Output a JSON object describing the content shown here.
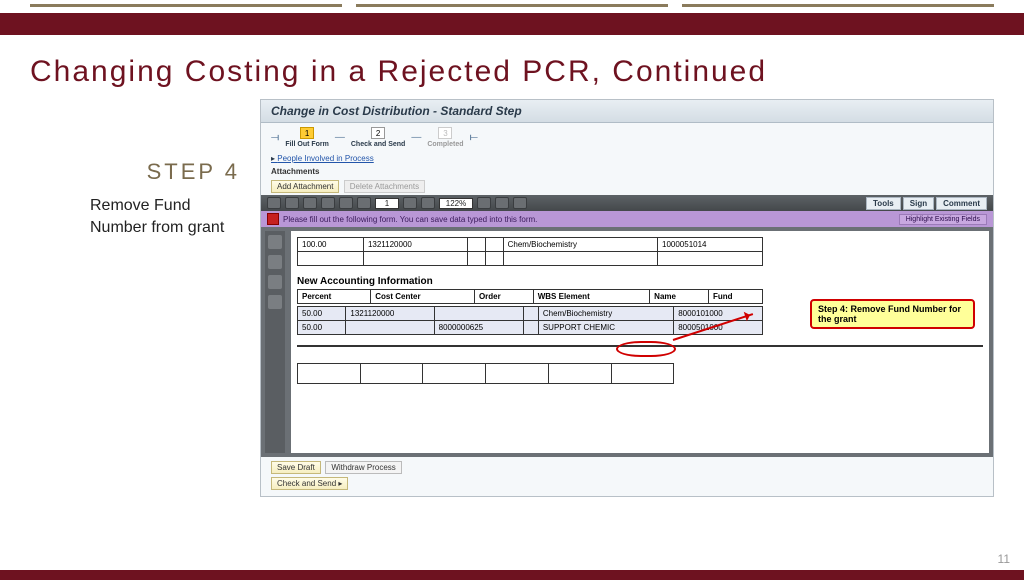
{
  "slide": {
    "title": "Changing Costing in a Rejected PCR, Continued",
    "step_label": "STEP 4",
    "step_text": "Remove Fund Number from grant",
    "page_number": "11"
  },
  "screenshot": {
    "window_title": "Change in Cost Distribution - Standard Step",
    "wizard": {
      "step1": {
        "num": "1",
        "label": "Fill Out Form"
      },
      "step2": {
        "num": "2",
        "label": "Check and Send"
      },
      "step3": {
        "num": "3",
        "label": "Completed"
      }
    },
    "people_link": "People Involved in Process",
    "attachments_label": "Attachments",
    "buttons": {
      "add_attachment": "Add Attachment",
      "delete_attachments": "Delete Attachments",
      "save_draft": "Save Draft",
      "withdraw": "Withdraw Process",
      "check_send": "Check and Send ▸"
    },
    "pdf_toolbar": {
      "page": "1",
      "zoom": "122%",
      "tools": "Tools",
      "sign": "Sign",
      "comment": "Comment"
    },
    "purple_bar": {
      "msg": "Please fill out the following form. You can save data typed into this form.",
      "highlight": "Highlight Existing Fields"
    },
    "top_row": {
      "c1": "100.00",
      "c2": "1321120000",
      "c5": "Chem/Biochemistry",
      "c6": "1000051014"
    },
    "section_title": "New Accounting Information",
    "headers": {
      "h1": "Percent",
      "h2": "Cost Center",
      "h3": "Order",
      "h4": "WBS Element",
      "h5": "Name",
      "h6": "Fund"
    },
    "rows": [
      {
        "percent": "50.00",
        "cost_center": "1321120000",
        "order": "",
        "wbs": "",
        "name": "Chem/Biochemistry",
        "fund": "8000101000"
      },
      {
        "percent": "50.00",
        "cost_center": "",
        "order": "8000000625",
        "wbs": "",
        "name": "SUPPORT CHEMIC",
        "fund": "8000501000"
      }
    ],
    "callout": "Step 4: Remove Fund Number for the grant"
  }
}
